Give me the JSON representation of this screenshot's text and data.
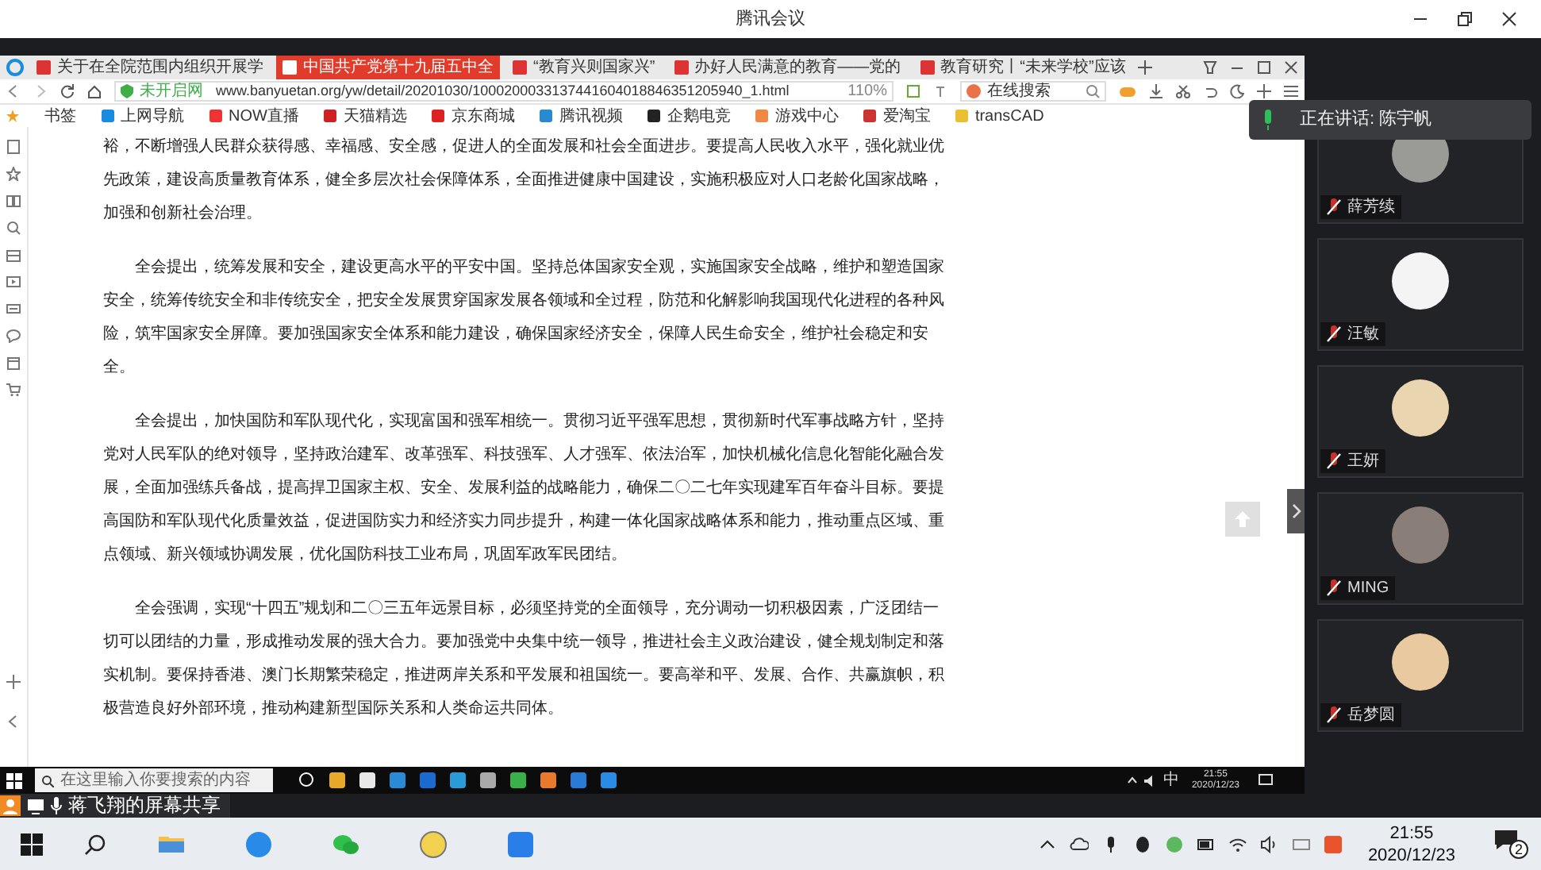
{
  "window": {
    "title": "腾讯会议"
  },
  "browser": {
    "tabs": [
      {
        "label": "关于在全院范围内组织开展学",
        "selected": false
      },
      {
        "label": "中国共产党第十九届五中全",
        "selected": true
      },
      {
        "label": "“教育兴则国家兴”",
        "selected": false
      },
      {
        "label": "办好人民满意的教育——党的",
        "selected": false
      },
      {
        "label": "教育研究丨“未来学校”应该",
        "selected": false
      }
    ],
    "address": {
      "security": "未开启网",
      "url": "www.banyuetan.org/yw/detail/20201030/1000200033137441604018846351205940_1.html",
      "zoom": "110%",
      "search": "在线搜索"
    },
    "bookmarks": [
      "书签",
      "上网导航",
      "NOW直播",
      "天猫精选",
      "京东商城",
      "腾讯视频",
      "企鹅电竞",
      "游戏中心",
      "爱淘宝",
      "transCAD"
    ],
    "article": {
      "paragraphs": [
        {
          "text": "裕，不断增强人民群众获得感、幸福感、安全感，促进人的全面发展和社会全面进步。要提高人民收入水平，强化就业优先政策，建设高质量教育体系，健全多层次社会保障体系，全面推进健康中国建设，实施积极应对人口老龄化国家战略，加强和创新社会治理。",
          "indent": false
        },
        {
          "text": "全会提出，统筹发展和安全，建设更高水平的平安中国。坚持总体国家安全观，实施国家安全战略，维护和塑造国家安全，统筹传统安全和非传统安全，把安全发展贯穿国家发展各领域和全过程，防范和化解影响我国现代化进程的各种风险，筑牢国家安全屏障。要加强国家安全体系和能力建设，确保国家经济安全，保障人民生命安全，维护社会稳定和安全。",
          "indent": true
        },
        {
          "text": "全会提出，加快国防和军队现代化，实现富国和强军相统一。贯彻习近平强军思想，贯彻新时代军事战略方针，坚持党对人民军队的绝对领导，坚持政治建军、改革强军、科技强军、人才强军、依法治军，加快机械化信息化智能化融合发展，全面加强练兵备战，提高捍卫国家主权、安全、发展利益的战略能力，确保二〇二七年实现建军百年奋斗目标。要提高国防和军队现代化质量效益，促进国防实力和经济实力同步提升，构建一体化国家战略体系和能力，推动重点区域、重点领域、新兴领域协调发展，优化国防科技工业布局，巩固军政军民团结。",
          "indent": true
        },
        {
          "text": "全会强调，实现“十四五”规划和二〇三五年远景目标，必须坚持党的全面领导，充分调动一切积极因素，广泛团结一切可以团结的力量，形成推动发展的强大合力。要加强党中央集中统一领导，推进社会主义政治建设，健全规划制定和落实机制。要保持香港、澳门长期繁荣稳定，推进两岸关系和平发展和祖国统一。要高举和平、发展、合作、共赢旗帜，积极营造良好外部环境，推动构建新型国际关系和人类命运共同体。",
          "indent": true
        }
      ]
    }
  },
  "shared_taskbar": {
    "search_placeholder": "在这里输入你要搜索的内容",
    "ime": "中",
    "time": "21:55",
    "date": "2020/12/23"
  },
  "share_label": "蒋飞翔的屏幕共享",
  "speaking": {
    "label": "正在讲话: 陈宇帆"
  },
  "participants": [
    {
      "name": "薛芳续"
    },
    {
      "name": "汪敏"
    },
    {
      "name": "王妍"
    },
    {
      "name": "MING"
    },
    {
      "name": "岳梦圆"
    }
  ],
  "taskbar": {
    "time": "21:55",
    "date": "2020/12/23",
    "notifications": "2"
  }
}
